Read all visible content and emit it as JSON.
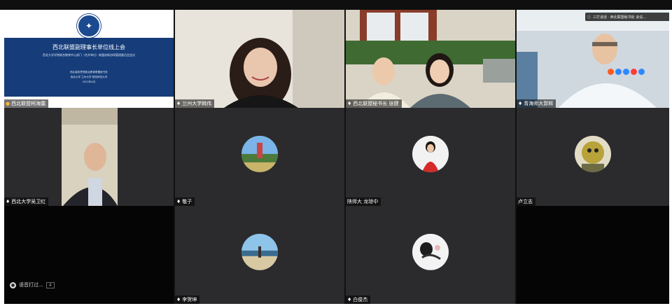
{
  "participants": [
    {
      "name": "西北联盟柯海露",
      "mic": "orange"
    },
    {
      "name": "兰州大学韩伟",
      "mic": "white"
    },
    {
      "name": "西北联盟秘书长 张健",
      "mic": "white"
    },
    {
      "name": "青海师大郭辉",
      "mic": "white"
    },
    {
      "name": "西北大学吴卫红",
      "mic": "white"
    },
    {
      "name": "敬子",
      "mic": "white"
    },
    {
      "name": "陕师大 龙琼中",
      "mic": "none"
    },
    {
      "name": "卢立志",
      "mic": "none"
    },
    {
      "name": "李贺坤",
      "mic": "white"
    },
    {
      "name": "白俊杰",
      "mic": "white"
    }
  ],
  "slide": {
    "title": "西北联盟副理事长单位线上会",
    "subtitle": "西北大学学院联合教育中心部门（合并单位）联盟创新协同管理委员会会议",
    "org_line1": "西北高校思想政治教育联盟秘书处",
    "org_line2": "西北大学 兰州大学 陕西师范大学",
    "date": "2022年4月"
  },
  "overlay": {
    "caption": "三打谈话 · 西北联盟秘书处 会议..."
  },
  "meeting": {
    "label": "语音打过...",
    "badge": "4"
  },
  "colors": {
    "tile_bg": "#2b2b2d",
    "slide_band": "#163d7a",
    "mic_active": "#ffb23a"
  }
}
